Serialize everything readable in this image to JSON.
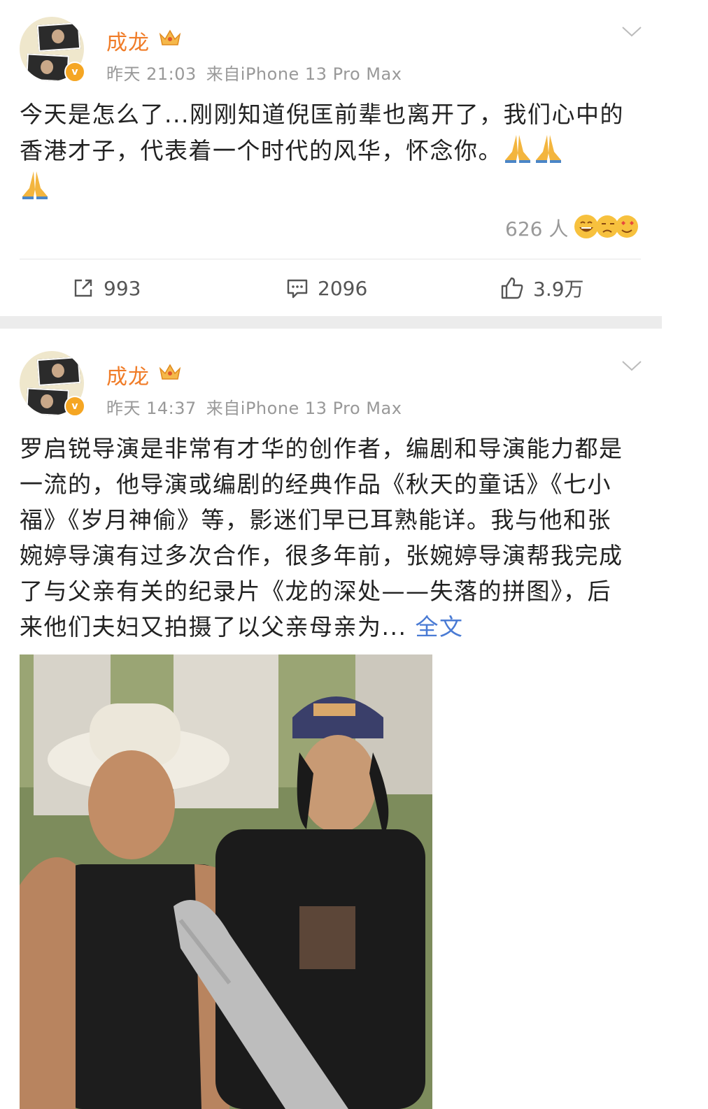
{
  "posts": [
    {
      "author": "成龙",
      "time": "昨天 21:03",
      "source": "来自iPhone 13 Pro Max",
      "text": "今天是怎么了...刚刚知道倪匡前辈也离开了，我们心中的香港才子，代表着一个时代的风华，怀念你。",
      "emoji_icons": [
        "pray-icon",
        "pray-icon",
        "pray-icon"
      ],
      "reactions": {
        "count": "626 人",
        "icons": [
          "laugh-emoji",
          "cry-emoji",
          "heart-eyes-emoji"
        ]
      },
      "actions": {
        "repost": "993",
        "comment": "2096",
        "like": "3.9万"
      }
    },
    {
      "author": "成龙",
      "time": "昨天 14:37",
      "source": "来自iPhone 13 Pro Max",
      "text": "罗启锐导演是非常有才华的创作者，编剧和导演能力都是一流的，他导演或编剧的经典作品《秋天的童话》《七小福》《岁月神偷》等，影迷们早已耳熟能详。我与他和张婉婷导演有过多次合作，很多年前，张婉婷导演帮我完成了与父亲有关的纪录片《龙的深处——失落的拼图》，后来他们夫妇又拍摄了以父亲母亲为...",
      "more_link": "全文",
      "image": "photo-two-men-on-film-set"
    }
  ],
  "colors": {
    "username": "#f07c28",
    "meta": "#999999",
    "link": "#4a7bd4",
    "separator": "#ececec",
    "verified": "#f5a623"
  }
}
